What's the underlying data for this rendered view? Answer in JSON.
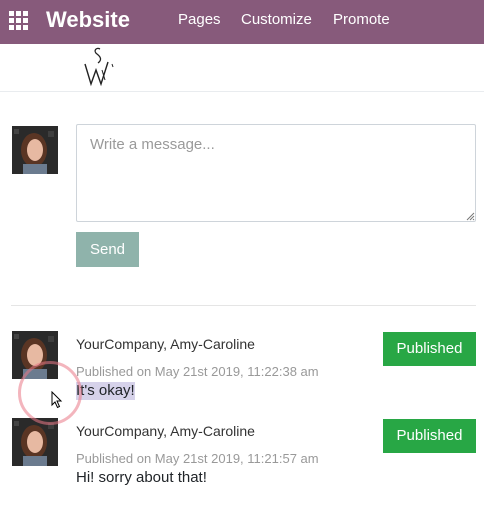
{
  "navbar": {
    "app_title": "Website",
    "menu": [
      {
        "label": "Pages"
      },
      {
        "label": "Customize"
      },
      {
        "label": "Promote"
      }
    ],
    "background_color": "#875a7b"
  },
  "logo": {
    "icon": "sw-monogram-logo"
  },
  "composer": {
    "placeholder": "Write a message...",
    "value": "",
    "send_label": "Send",
    "send_color": "#8fb3ab"
  },
  "messages": [
    {
      "author": "YourCompany, Amy-Caroline",
      "published": "Published on May 21st 2019, 11:22:38 am",
      "text": "It's okay!",
      "status_label": "Published",
      "selected": true
    },
    {
      "author": "YourCompany, Amy-Caroline",
      "published": "Published on May 21st 2019, 11:21:57 am",
      "text": "Hi! sorry about that!",
      "status_label": "Published",
      "selected": false
    }
  ],
  "status_color": "#28a745"
}
